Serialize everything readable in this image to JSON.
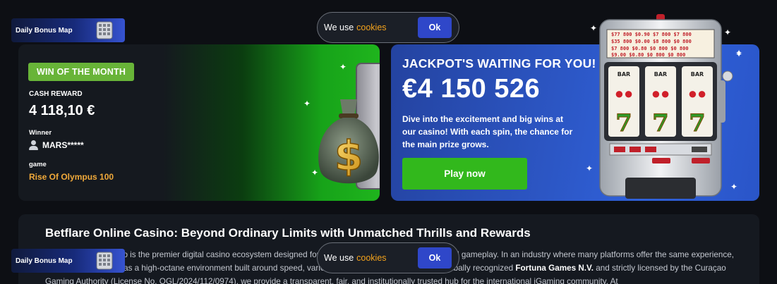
{
  "bonus_widget": {
    "label": "Daily Bonus Map",
    "icon": "map-grid-icon"
  },
  "cookie": {
    "text": "We use",
    "link": "cookies",
    "ok_label": "Ok"
  },
  "win": {
    "badge": "WIN OF THE MONTH",
    "cash_label": "CASH REWARD",
    "cash_value": "4 118,10 €",
    "winner_label": "Winner",
    "winner_name": "MARS*****",
    "game_label": "game",
    "game_value": "Rise Of Olympus 100"
  },
  "jackpot": {
    "title": "JACKPOT'S WAITING FOR YOU!",
    "amount": "€4 150 526",
    "description": "Dive into the excitement and big wins at our casino! With each spin, the chance for the main prize grows.",
    "play_label": "Play now"
  },
  "slot_machine": {
    "paytable": [
      [
        "$77 800",
        "$0.90",
        "$7 800",
        "$7 800"
      ],
      [
        "$35 800",
        "$0.00",
        "$8 800",
        "$0 800"
      ],
      [
        "$7 800",
        "$0.80",
        "$0 800",
        "$0 800"
      ],
      [
        "$9.00",
        "$0.80",
        "$0 800",
        "$0 800"
      ]
    ],
    "reel_label": "BAR"
  },
  "article": {
    "title": "Betflare Online Casino: Beyond Ordinary Limits with Unmatched Thrills and Rewards",
    "p1_a": "Betflare Online Casino is the premier digital casino ecosystem designed for players who want more than standard gameplay. In an industry where many platforms offer the same",
    "p1_b": "experience, Betflare stands apart as a high-octane environment built around speed, variety, and reward. Operated by the globally recognized",
    "p1_company": "Fortuna Games N.V.",
    "p1_c": "and strictly",
    "p2": "licensed by the Curaçao Gaming Authority (License No. OGL/2024/112/0974), we provide a transparent, fair, and institutionally trusted hub for the international iGaming community. At"
  },
  "colors": {
    "page_bg": "#0d0f14",
    "badge_green": "#68b438",
    "play_green": "#32b81c",
    "jackpot_blue": "#2c56c4",
    "accent_orange": "#f3a21c",
    "ok_blue": "#2f47c9"
  }
}
